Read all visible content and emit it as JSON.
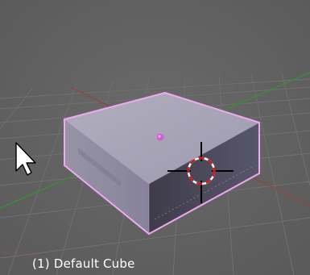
{
  "viewport": {
    "object_label": "(1) Default Cube"
  },
  "colors": {
    "background": "#626262",
    "grid": "#6e6e6e",
    "x_axis": "#8a4848",
    "y_axis": "#3c8a3c",
    "selection_outline": "#f0a8f0",
    "cube_top": "#a8a4b6",
    "cube_front": "#8e8a9c",
    "cube_right": "#4a4856",
    "origin": "#d060d0",
    "cursor_ring_red": "#d01818",
    "cursor_ring_white": "#ffffff"
  },
  "icons": {
    "mouse_pointer": "mouse-pointer-icon",
    "cursor": "3d-cursor-icon",
    "origin": "object-origin-icon"
  }
}
